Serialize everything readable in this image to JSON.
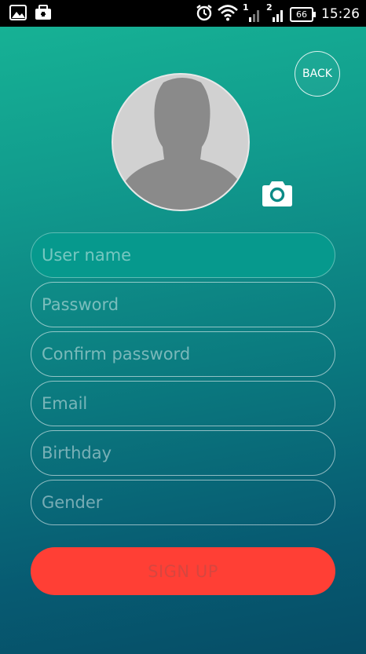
{
  "status_bar": {
    "time": "15:26",
    "battery": "66",
    "sim1_label": "1",
    "sim2_label": "2"
  },
  "header": {
    "back_label": "BACK"
  },
  "form": {
    "fields": [
      {
        "placeholder": "User name"
      },
      {
        "placeholder": "Password"
      },
      {
        "placeholder": "Confirm password"
      },
      {
        "placeholder": "Email"
      },
      {
        "placeholder": "Birthday"
      },
      {
        "placeholder": "Gender"
      }
    ],
    "submit_label": "SIGN UP"
  },
  "colors": {
    "accent_button": "#ff3f35",
    "active_field": "#06998d",
    "gradient_top": "#17b596",
    "gradient_bottom": "#064d66"
  }
}
